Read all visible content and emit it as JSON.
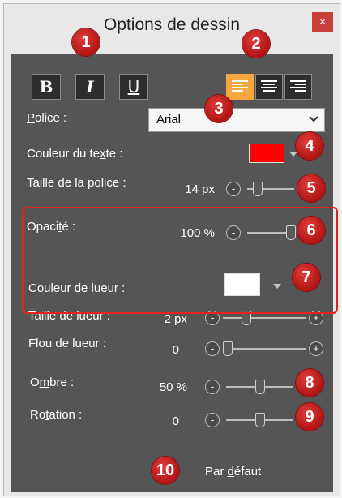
{
  "window": {
    "title": "Options de dessin",
    "close_label": "×"
  },
  "format_buttons": {
    "bold": "B",
    "italic": "I",
    "underline": "U"
  },
  "font": {
    "label_key": "P",
    "label_rest": "olice :",
    "value": "Arial"
  },
  "text_color": {
    "label_pre": "Couleur du te",
    "label_key": "x",
    "label_post": "te :",
    "color": "#ff0000"
  },
  "font_size": {
    "label": "Taille de la police :",
    "value": "14 px",
    "level": 0.15
  },
  "opacity": {
    "label_pre": "Opaci",
    "label_key": "t",
    "label_post": "é :",
    "value": "100 %",
    "level": 1.0
  },
  "glow_color": {
    "label": "Couleur de lueur :",
    "color": "#ffffff"
  },
  "glow_size": {
    "label": "Taille de lueur :",
    "value": "2 px",
    "level": 0.25
  },
  "glow_blur": {
    "label": "Flou de lueur :",
    "value": "0",
    "level": 0.0
  },
  "shadow": {
    "label_pre": "O",
    "label_key": "m",
    "label_post": "bre :",
    "value": "50 %",
    "level": 0.5
  },
  "rotation": {
    "label_pre": "Ro",
    "label_key": "t",
    "label_post": "ation :",
    "value": "0",
    "level": 0.5
  },
  "default_button": {
    "label_pre": "Par ",
    "label_key": "d",
    "label_post": "éfaut"
  },
  "badges": [
    "1",
    "2",
    "3",
    "4",
    "5",
    "6",
    "7",
    "8",
    "9",
    "10"
  ],
  "colors": {
    "accent": "#f6a63d",
    "badge": "#c41e1e",
    "panel": "#555555",
    "highlight_box": "#e52222"
  }
}
